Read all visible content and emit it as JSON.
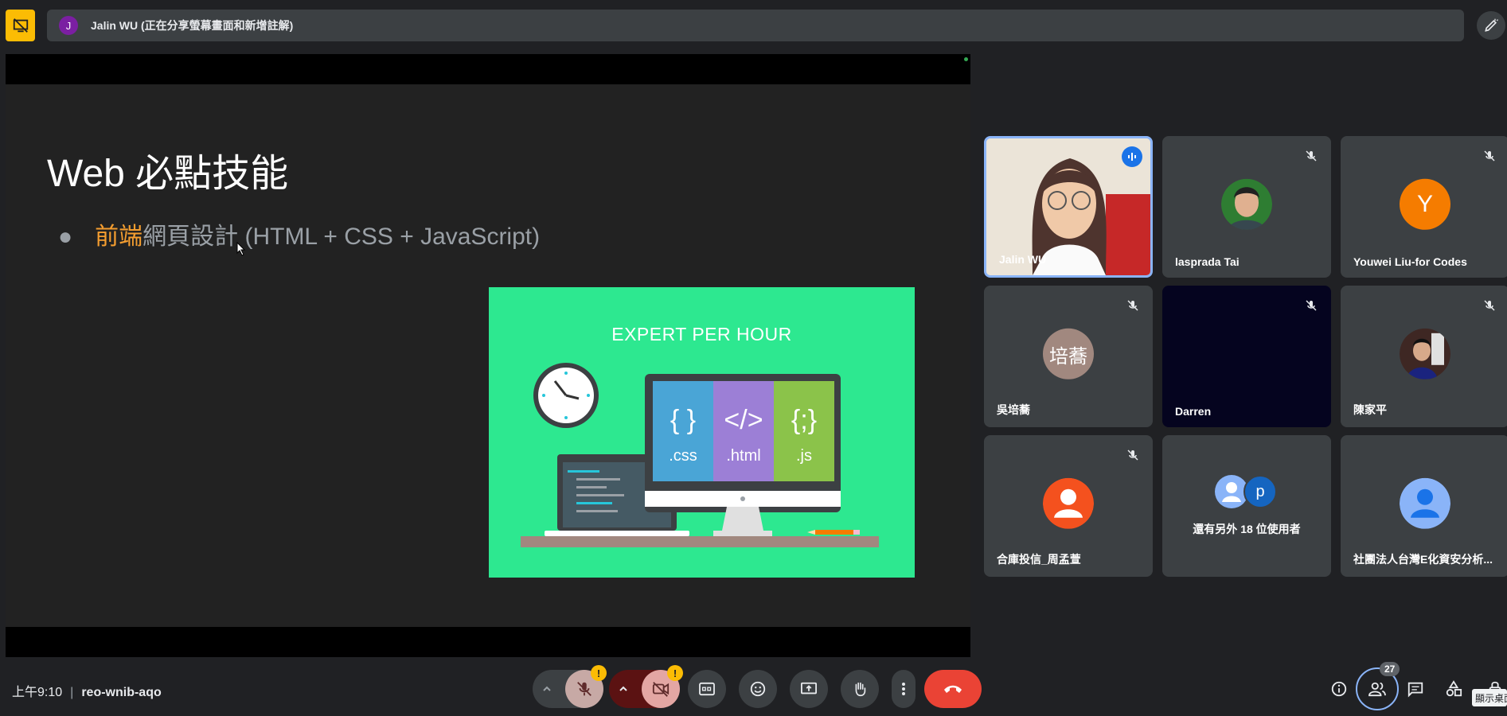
{
  "banner": {
    "avatar_letter": "J",
    "text": "Jalin WU (正在分享螢幕畫面和新增註解)"
  },
  "slide": {
    "title": "Web 必點技能",
    "bullet_bullet": "●",
    "bullet_highlight": "前端",
    "bullet_rest": "網頁設計 (HTML + CSS + JavaScript)",
    "illustration": {
      "title": "EXPERT PER HOUR",
      "css_symbol": "{ }",
      "css_label": ".css",
      "html_symbol": "</>",
      "html_label": ".html",
      "js_symbol": "{;}",
      "js_label": ".js"
    }
  },
  "participants": [
    {
      "name": "Jalin WU",
      "active": true
    },
    {
      "name": "lasprada Tai"
    },
    {
      "name": "Youwei Liu-for Codes",
      "avatar_letter": "Y",
      "avatar_color": "#f57c00"
    },
    {
      "name": "吳培蕎",
      "avatar_letter": "培蕎",
      "avatar_color": "#a1887f"
    },
    {
      "name": "Darren"
    },
    {
      "name": "陳家平"
    },
    {
      "name": "合庫投信_周孟萱",
      "avatar_color": "#f4511e"
    },
    {
      "name": "",
      "more_text": "還有另外 18 位使用者",
      "avatar_letter": "p"
    },
    {
      "name": "社團法人台灣E化資安分析..."
    }
  ],
  "bottom": {
    "time": "上午9:10",
    "separator": "|",
    "meeting_code": "reo-wnib-aqo",
    "mic_badge": "!",
    "cam_badge": "!",
    "people_count": "27",
    "tooltip": "顯示桌面"
  },
  "colors": {
    "accent": "#8ab4f8",
    "end_call": "#ea4335",
    "warning": "#fbbc04",
    "slide_green": "#2de890"
  }
}
